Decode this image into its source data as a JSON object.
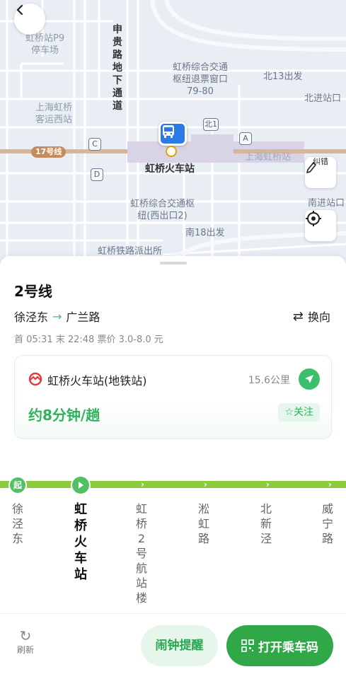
{
  "colors": {
    "primary_green": "#30a848",
    "line_green": "#8acc3c",
    "text_green": "#2fb15d",
    "pin_blue": "#2c7be5",
    "map_bg": "#e9eef5"
  },
  "map": {
    "labels": {
      "p9": "虹桥站P9\n停车场",
      "shen_gui_road": "申贵路地下通道",
      "refund_window": "虹桥综合交通\n枢纽退票窗口\n79-80",
      "north13": "北13出发",
      "north_exit": "北进站口",
      "bus_west": "上海虹桥\n客运西站",
      "station": "虹桥火车站",
      "shanghai_hongqiao": "上海虹桥站",
      "west_exit2": "虹桥综合交通枢\n纽(西出口2)",
      "south_exit": "南进站口",
      "south18": "南18出发",
      "police": "虹桥铁路派出所",
      "route17": "17号线",
      "north1": "北1"
    },
    "exits": [
      "A",
      "C",
      "D"
    ],
    "fix_label": "纠错",
    "icons": {
      "back": "chevron-left-icon",
      "fix": "edit-pen-icon",
      "locate": "locate-icon",
      "pin": "bus-icon"
    }
  },
  "sheet": {
    "line_name": "2号线",
    "from": "徐泾东",
    "to": "广兰路",
    "switch_label": "换向",
    "schedule": "首 05:31 末 22:48 票价 3.0-8.0 元",
    "card": {
      "station": "虹桥火车站(地铁站)",
      "distance": "15.6公里",
      "frequency": "约8分钟/趟",
      "follow": "☆关注"
    },
    "start_badge": "起",
    "stops": [
      "徐泾东",
      "虹桥火车站",
      "虹桥2号航站楼",
      "淞虹路",
      "北新泾",
      "威宁路"
    ],
    "current_stop_index": 1
  },
  "bottom": {
    "refresh": "刷新",
    "alarm": "闹钟提醒",
    "ride": "打开乘车码"
  }
}
